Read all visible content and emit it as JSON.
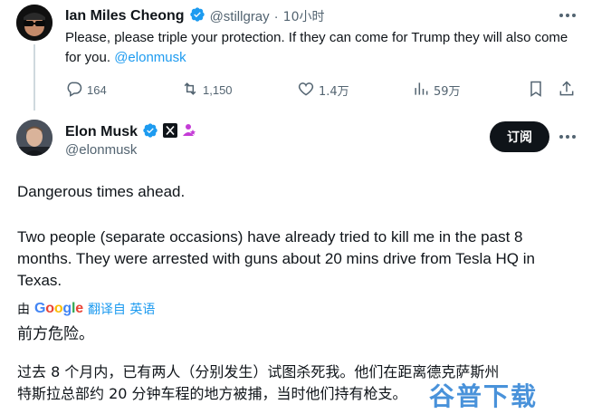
{
  "tweet1": {
    "display_name": "Ian Miles Cheong",
    "handle": "@stillgray",
    "separator": "·",
    "time": "10小时",
    "text_before": "Please, please triple your protection. If they can come for Trump they will also come for you. ",
    "mention": "@elonmusk",
    "actions": {
      "replies": "164",
      "retweets": "1,150",
      "likes": "1.4万",
      "views": "59万"
    }
  },
  "tweet2": {
    "display_name": "Elon Musk",
    "handle": "@elonmusk",
    "follow_label": "订阅",
    "paragraph1": "Dangerous times ahead.",
    "paragraph2": "Two people (separate occasions) have already tried to kill me in the past 8 months. They were arrested with guns about 20 mins drive from Tesla HQ in Texas.",
    "translate_prefix": "由",
    "translate_suffix": "翻译自 英语",
    "translated1": "前方危险。",
    "translated2_line1": "过去 8 个月内，已有两人（分别发生）试图杀死我。他们在距离德克萨斯州",
    "translated2_line2": "特斯拉总部约 20 分钟车程的地方被捕，当时他们持有枪支。"
  },
  "watermark": "谷普下载",
  "colors": {
    "accent": "#1d9bf0",
    "text": "#0f1419",
    "muted": "#536471",
    "gold": "#e2b719",
    "gov_purple": "#c43bd6"
  },
  "icons": [
    "verified-gold-icon",
    "more-icon",
    "reply-icon",
    "retweet-icon",
    "like-icon",
    "views-icon",
    "bookmark-icon",
    "share-icon",
    "x-logo-badge-icon",
    "affiliate-badge-icon"
  ]
}
